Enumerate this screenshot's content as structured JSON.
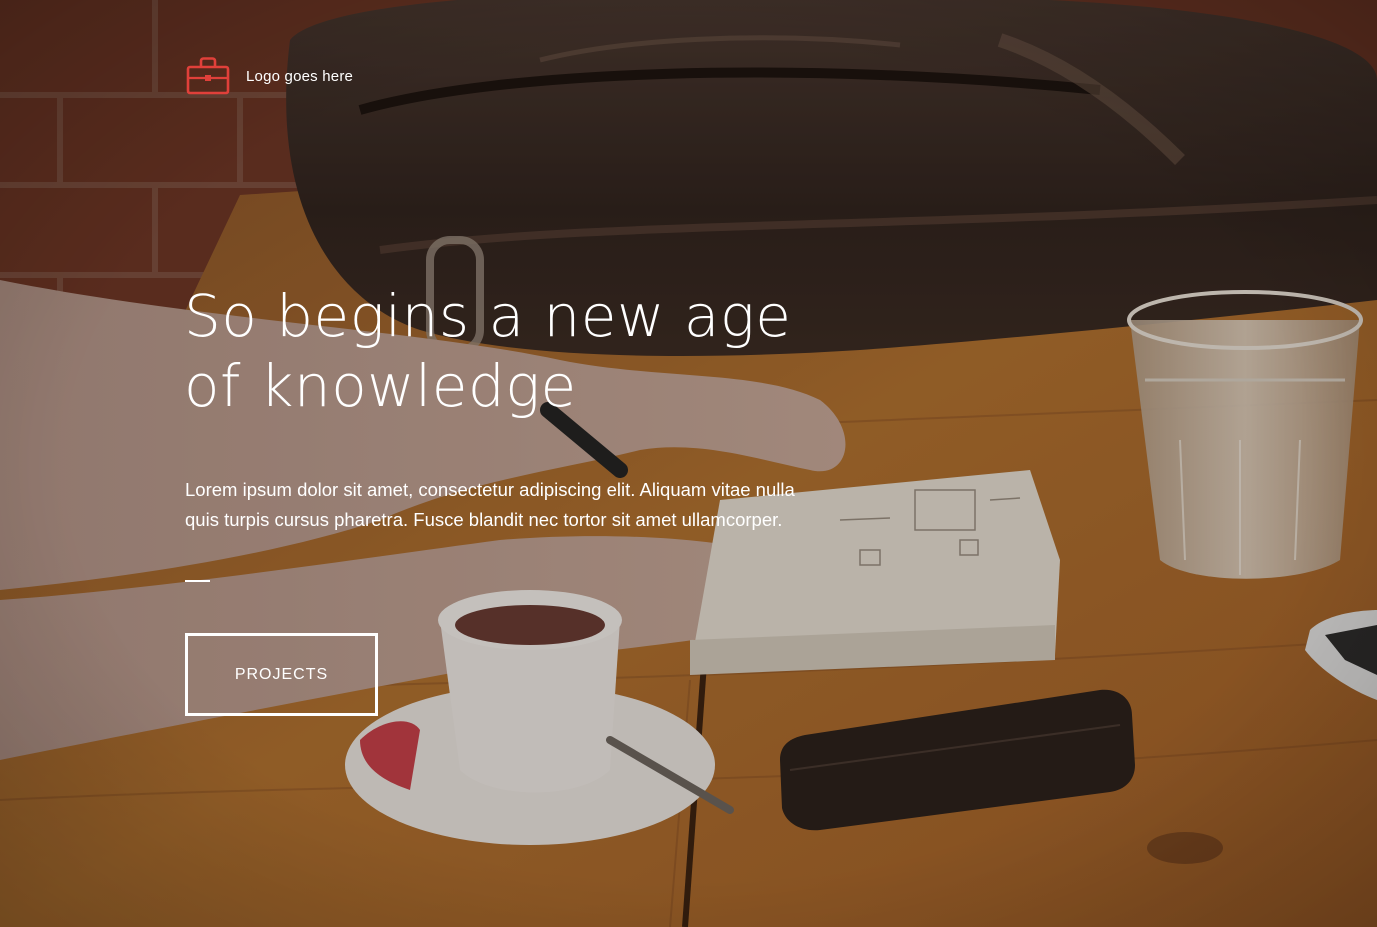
{
  "header": {
    "logo_icon": "briefcase-icon",
    "logo_text": "Logo goes here"
  },
  "hero": {
    "headline_line1": "So begins a new age",
    "headline_line2": "of knowledge",
    "lede": "Lorem ipsum dolor sit amet, consectetur adipiscing elit. Aliquam vitae nulla quis turpis cursus pharetra. Fusce blandit nec tortor sit amet ullamcorper.",
    "cta_label": "PROJECTS"
  },
  "colors": {
    "accent": "#e0403a",
    "text": "#ffffff",
    "wood": "#a0652e"
  }
}
